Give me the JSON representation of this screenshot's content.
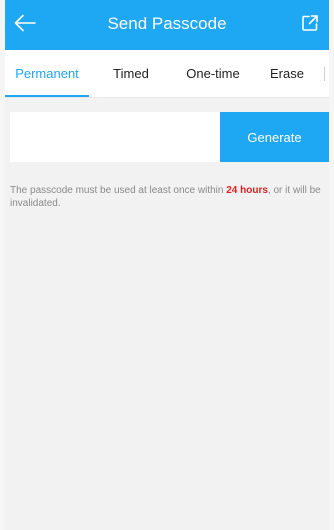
{
  "header": {
    "title": "Send Passcode",
    "background": "#1ea7f2",
    "back_icon": "arrow-left-icon",
    "share_icon": "external-share-icon"
  },
  "tabs": [
    {
      "label": "Permanent",
      "active": true
    },
    {
      "label": "Timed",
      "active": false
    },
    {
      "label": "One-time",
      "active": false
    },
    {
      "label": "Erase",
      "active": false
    }
  ],
  "form": {
    "passcode_value": "",
    "generate_label": "Generate"
  },
  "hint": {
    "before": "The passcode must be used at least once within ",
    "highlight": "24 hours",
    "after": ", or it will be invalidated.",
    "highlight_color": "#e02020"
  }
}
